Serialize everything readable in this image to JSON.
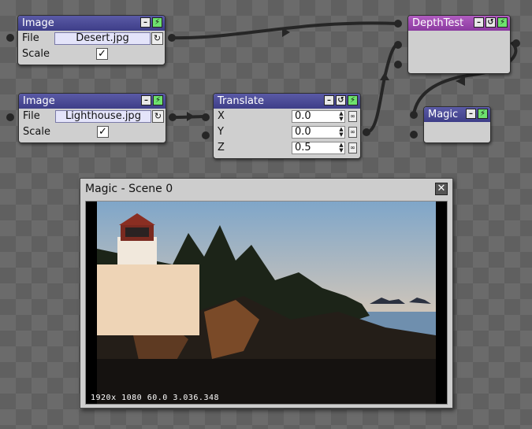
{
  "nodes": {
    "image_desert": {
      "title": "Image",
      "file_label": "File",
      "file_value": "Desert.jpg",
      "scale_label": "Scale",
      "scale_checked": "✓"
    },
    "image_lighthouse": {
      "title": "Image",
      "file_label": "File",
      "file_value": "Lighthouse.jpg",
      "scale_label": "Scale",
      "scale_checked": "✓"
    },
    "translate": {
      "title": "Translate",
      "x_label": "X",
      "x_value": "0.0",
      "y_label": "Y",
      "y_value": "0.0",
      "z_label": "Z",
      "z_value": "0.5"
    },
    "depthtest": {
      "title": "DepthTest"
    },
    "magic": {
      "title": "Magic"
    }
  },
  "preview_window": {
    "title": "Magic - Scene 0",
    "stats": "1920x 1080  60.0  3.036.348"
  },
  "colors": {
    "header_blue": "#4a4a96",
    "header_purple": "#9b48b0",
    "wire": "#262626",
    "power_green": "#6ee26e"
  },
  "icons": {
    "minimize": "minimize-icon",
    "power": "power-icon",
    "loop": "loop-icon",
    "reload": "reload-icon",
    "link": "link-icon",
    "close": "close-icon"
  }
}
